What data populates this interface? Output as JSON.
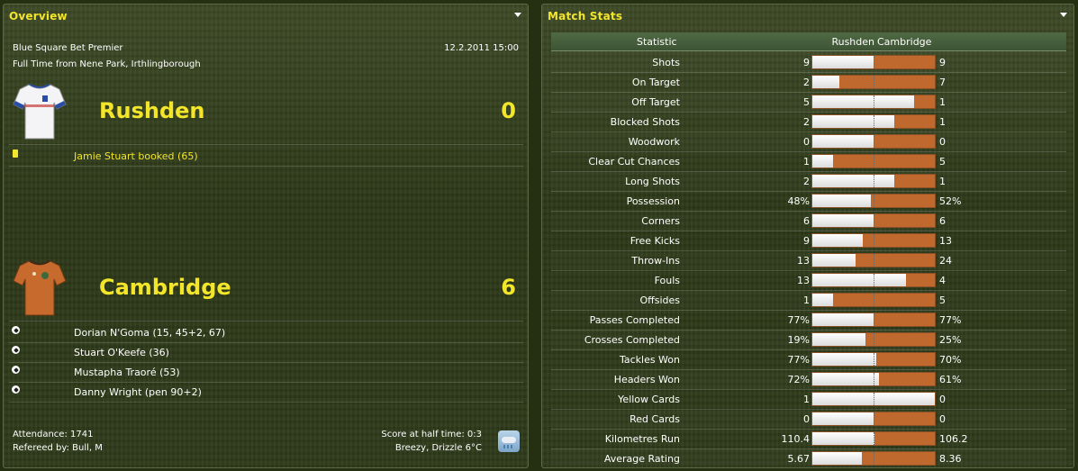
{
  "overview": {
    "title": "Overview",
    "competition": "Blue Square Bet Premier",
    "datetime": "12.2.2011 15:00",
    "venue": "Full Time from Nene Park, Irthlingborough",
    "home": {
      "name": "Rushden",
      "score": "0",
      "shirt_icon": "white-blue-shirt-icon",
      "events": [
        {
          "icon": "yellow-card-icon",
          "text": "Jamie Stuart booked (65)"
        }
      ]
    },
    "away": {
      "name": "Cambridge",
      "score": "6",
      "shirt_icon": "orange-shirt-icon",
      "events": [
        {
          "icon": "ball-icon",
          "text": "Dorian N'Goma (15, 45+2, 67)"
        },
        {
          "icon": "ball-icon",
          "text": "Stuart O'Keefe (36)"
        },
        {
          "icon": "ball-icon",
          "text": "Mustapha Traoré (53)"
        },
        {
          "icon": "ball-icon",
          "text": "Danny Wright (pen 90+2)"
        }
      ]
    },
    "attendance": "Attendance: 1741",
    "referee": "Refereed by: Bull, M",
    "halftime": "Score at half time: 0:3",
    "weather": "Breezy, Drizzle 6°C",
    "weather_icon": "drizzle-weather-icon"
  },
  "match_stats": {
    "title": "Match Stats",
    "col_statistic": "Statistic",
    "col_home": "Rushden",
    "col_away": "Cambridge",
    "colors": {
      "home_bar": "#ffffff",
      "away_bar": "#c0692e",
      "title": "#f2e52a"
    },
    "rows": [
      {
        "label": "Shots",
        "home": "9",
        "away": "9",
        "home_share": 0.5
      },
      {
        "label": "On Target",
        "home": "2",
        "away": "7",
        "home_share": 0.222
      },
      {
        "label": "Off Target",
        "home": "5",
        "away": "1",
        "home_share": 0.833
      },
      {
        "label": "Blocked Shots",
        "home": "2",
        "away": "1",
        "home_share": 0.667
      },
      {
        "label": "Woodwork",
        "home": "0",
        "away": "0",
        "home_share": 0.5
      },
      {
        "label": "Clear Cut Chances",
        "home": "1",
        "away": "5",
        "home_share": 0.167
      },
      {
        "label": "Long Shots",
        "home": "2",
        "away": "1",
        "home_share": 0.667
      },
      {
        "label": "Possession",
        "home": "48%",
        "away": "52%",
        "home_share": 0.48
      },
      {
        "label": "Corners",
        "home": "6",
        "away": "6",
        "home_share": 0.5
      },
      {
        "label": "Free Kicks",
        "home": "9",
        "away": "13",
        "home_share": 0.409
      },
      {
        "label": "Throw-Ins",
        "home": "13",
        "away": "24",
        "home_share": 0.351
      },
      {
        "label": "Fouls",
        "home": "13",
        "away": "4",
        "home_share": 0.765
      },
      {
        "label": "Offsides",
        "home": "1",
        "away": "5",
        "home_share": 0.167
      },
      {
        "label": "Passes Completed",
        "home": "77%",
        "away": "77%",
        "home_share": 0.5
      },
      {
        "label": "Crosses Completed",
        "home": "19%",
        "away": "25%",
        "home_share": 0.432
      },
      {
        "label": "Tackles Won",
        "home": "77%",
        "away": "70%",
        "home_share": 0.524
      },
      {
        "label": "Headers Won",
        "home": "72%",
        "away": "61%",
        "home_share": 0.541
      },
      {
        "label": "Yellow Cards",
        "home": "1",
        "away": "0",
        "home_share": 1.0
      },
      {
        "label": "Red Cards",
        "home": "0",
        "away": "0",
        "home_share": 0.5
      },
      {
        "label": "Kilometres Run",
        "home": "110.4",
        "away": "106.2",
        "home_share": 0.51
      },
      {
        "label": "Average Rating",
        "home": "5.67",
        "away": "8.36",
        "home_share": 0.404
      }
    ]
  }
}
